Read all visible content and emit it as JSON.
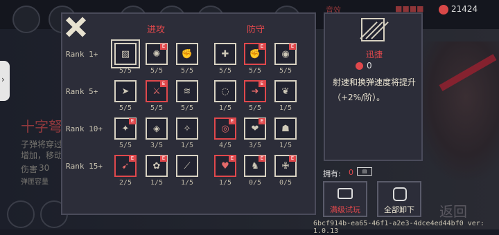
{
  "header": {
    "coins": "21424",
    "tabs": [
      "音效",
      "■■■■"
    ]
  },
  "perk_panel": {
    "attack_title": "进攻",
    "defense_title": "防守",
    "ranks": [
      {
        "label": "Rank 1+",
        "cells": [
          {
            "icon": "diagonal-lines-icon",
            "count": "5/5",
            "highlight": false,
            "badge": ""
          },
          {
            "icon": "spiral-icon",
            "count": "5/5",
            "highlight": false,
            "badge": "E"
          },
          {
            "icon": "fist-icon",
            "count": "5/5",
            "highlight": false,
            "badge": ""
          },
          {
            "icon": "cross-shield-icon",
            "count": "5/5",
            "highlight": false,
            "badge": ""
          },
          {
            "icon": "fist-red-icon",
            "count": "5/5",
            "highlight": true,
            "badge": "E"
          },
          {
            "icon": "eye-shield-icon",
            "count": "5/5",
            "highlight": false,
            "badge": "E"
          }
        ]
      },
      {
        "label": "Rank 5+",
        "cells": [
          {
            "icon": "arrow-icon",
            "count": "5/5",
            "highlight": false,
            "badge": ""
          },
          {
            "icon": "claw-icon",
            "count": "5/5",
            "highlight": true,
            "badge": "E"
          },
          {
            "icon": "wind-icon",
            "count": "5/5",
            "highlight": false,
            "badge": ""
          },
          {
            "icon": "swirl-icon",
            "count": "1/5",
            "highlight": false,
            "badge": ""
          },
          {
            "icon": "boot-icon",
            "count": "5/5",
            "highlight": true,
            "badge": "E"
          },
          {
            "icon": "leaf-icon",
            "count": "1/5",
            "highlight": false,
            "badge": ""
          }
        ]
      },
      {
        "label": "Rank 10+",
        "cells": [
          {
            "icon": "sparkle-icon",
            "count": "5/5",
            "highlight": false,
            "badge": "E"
          },
          {
            "icon": "rune-circle-icon",
            "count": "3/5",
            "highlight": false,
            "badge": ""
          },
          {
            "icon": "stars-icon",
            "count": "1/5",
            "highlight": false,
            "badge": ""
          },
          {
            "icon": "orb-icon",
            "count": "4/5",
            "highlight": true,
            "badge": "E"
          },
          {
            "icon": "hearts-icon",
            "count": "3/5",
            "highlight": false,
            "badge": "E"
          },
          {
            "icon": "ghost-icon",
            "count": "1/5",
            "highlight": false,
            "badge": ""
          }
        ]
      },
      {
        "label": "Rank 15+",
        "cells": [
          {
            "icon": "flame-icon",
            "count": "2/5",
            "highlight": true,
            "badge": "E"
          },
          {
            "icon": "bomb-cluster-icon",
            "count": "1/5",
            "highlight": false,
            "badge": "E"
          },
          {
            "icon": "slash-icon",
            "count": "1/5",
            "highlight": false,
            "badge": ""
          },
          {
            "icon": "heart-cross-icon",
            "count": "1/5",
            "highlight": true,
            "badge": "E"
          },
          {
            "icon": "creature-icon",
            "count": "0/5",
            "highlight": false,
            "badge": "E"
          },
          {
            "icon": "cross-heal-icon",
            "count": "0/5",
            "highlight": false,
            "badge": "E"
          }
        ]
      }
    ]
  },
  "detail": {
    "name": "迅捷",
    "cost": "0",
    "description": "射速和换弹速度将提升（+2%/阶）。"
  },
  "owned": {
    "label": "拥有:",
    "value": "0"
  },
  "buttons": {
    "trial": "满级试玩",
    "unequip_all": "全部卸下"
  },
  "background": {
    "weapon_name": "十字弩",
    "line1": "子弹将穿过",
    "line2": "增加，移动",
    "damage_label": "伤害",
    "damage_value": "30",
    "ammo_label": "弹匣容量",
    "back": "返回"
  },
  "version": "6bcf914b-ea65-46f1-a2e3-4dce4ed44bf0 ver: 1.0.13",
  "colors": {
    "accent": "#e0484c",
    "panel": "#2c2d39",
    "text": "#e8e2d0"
  }
}
